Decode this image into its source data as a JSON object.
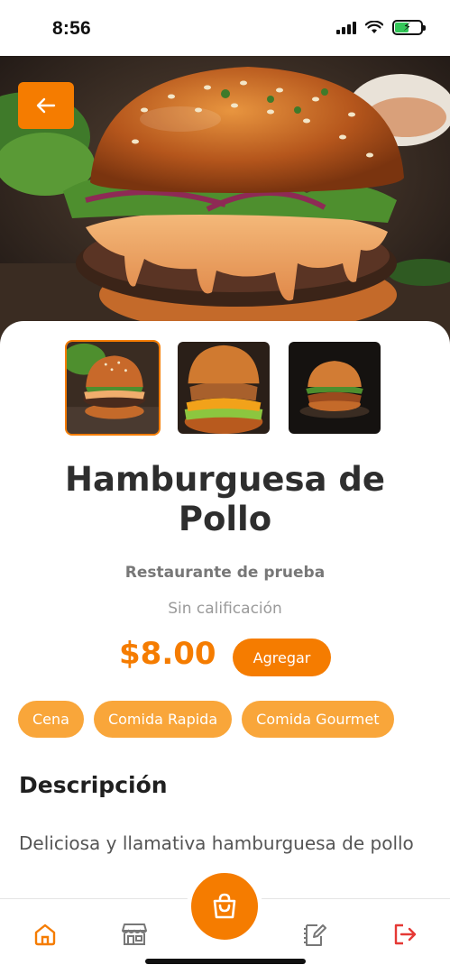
{
  "status_bar": {
    "time": "8:56",
    "icons": [
      "signal-icon",
      "wifi-icon",
      "battery-charging-icon"
    ],
    "battery_color": "#34c759"
  },
  "hero": {
    "back_icon": "arrow-left-icon",
    "image": "hamburger-photo"
  },
  "gallery": {
    "thumbnails": [
      {
        "image": "burger-thumbnail-1",
        "selected": true
      },
      {
        "image": "burger-thumbnail-2",
        "selected": false
      },
      {
        "image": "burger-thumbnail-3",
        "selected": false
      }
    ]
  },
  "product": {
    "title": "Hamburguesa de Pollo",
    "restaurant": "Restaurante de prueba",
    "rating_text": "Sin calificación",
    "price": "$8.00",
    "add_label": "Agregar",
    "tags": [
      "Cena",
      "Comida Rapida",
      "Comida Gourmet"
    ],
    "description_heading": "Descripción",
    "description": "Deliciosa y llamativa hamburguesa de pollo"
  },
  "bottom_nav": {
    "items": [
      {
        "icon": "home-icon",
        "active": true
      },
      {
        "icon": "store-icon",
        "active": false
      },
      {
        "icon": "shopping-bag-icon",
        "active": false
      },
      {
        "icon": "orders-edit-icon",
        "active": false
      },
      {
        "icon": "logout-icon",
        "active": false
      }
    ]
  },
  "colors": {
    "accent": "#f57c00",
    "tag_background": "#f9a63a",
    "logout": "#e53935",
    "text_dark": "#2e2e2e",
    "text_muted": "#777777"
  }
}
